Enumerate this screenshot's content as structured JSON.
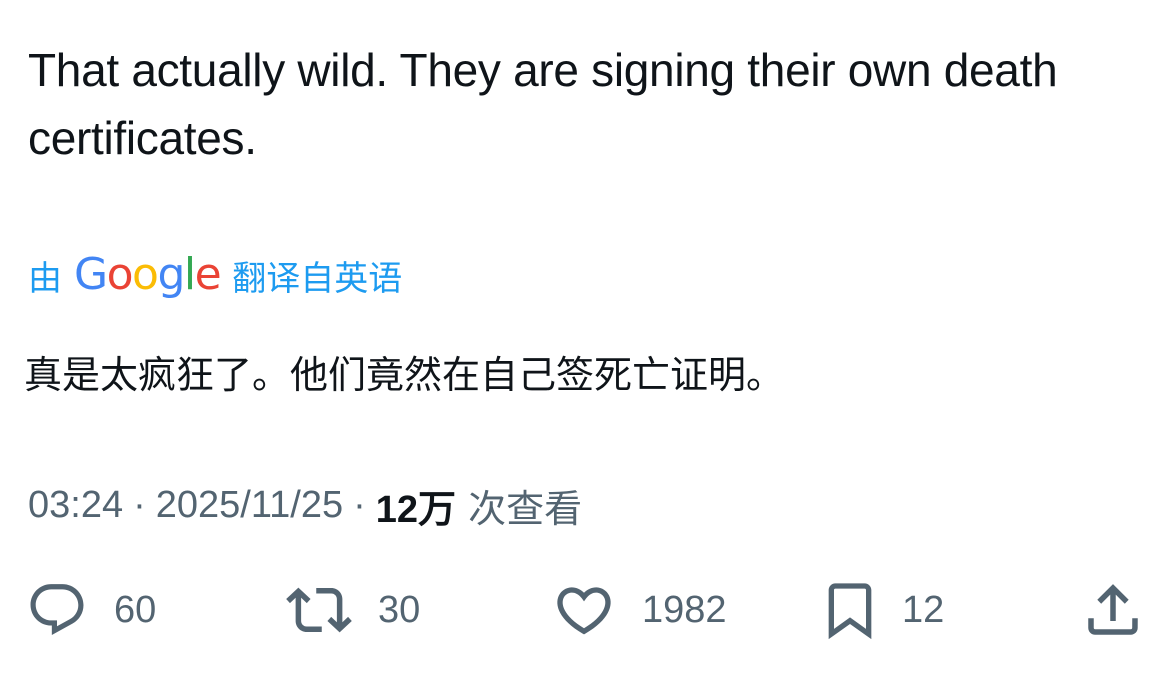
{
  "tweet": {
    "text": "That actually wild. They are signing their own death certificates."
  },
  "translation": {
    "by_label": "由",
    "google_letters": [
      {
        "char": "G",
        "color": "#4285F4"
      },
      {
        "char": "o",
        "color": "#EA4335"
      },
      {
        "char": "o",
        "color": "#FBBC05"
      },
      {
        "char": "g",
        "color": "#4285F4"
      },
      {
        "char": "l",
        "color": "#34A853"
      },
      {
        "char": "e",
        "color": "#EA4335"
      }
    ],
    "source_label": "翻译自英语",
    "text": "真是太疯狂了。他们竟然在自己签死亡证明。"
  },
  "meta": {
    "time": "03:24",
    "separator": "·",
    "date": "2025/11/25",
    "views_count": "12万",
    "views_label": "次查看"
  },
  "actions": {
    "replies": "60",
    "retweets": "30",
    "likes": "1982",
    "bookmarks": "12"
  },
  "colors": {
    "text_primary": "#0f1419",
    "text_secondary": "#536471",
    "link_blue": "#1d9bf0"
  }
}
